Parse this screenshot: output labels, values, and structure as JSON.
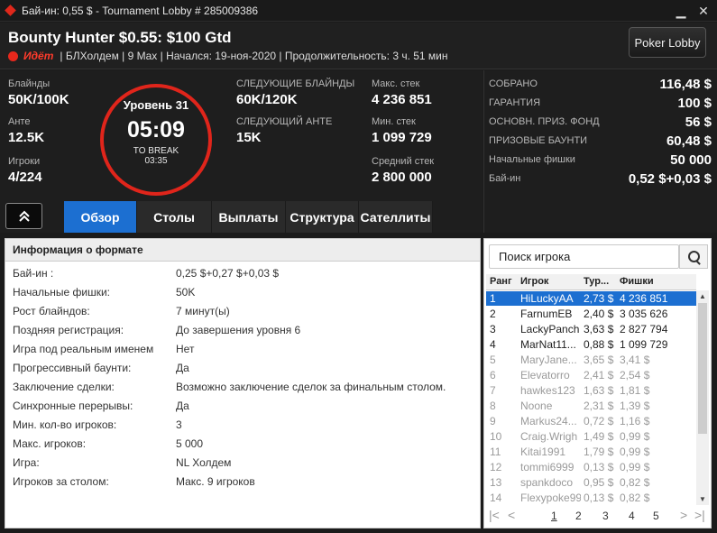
{
  "window": {
    "title": "Бай-ин: 0,55 $ - Tournament Lobby # 285009386"
  },
  "header": {
    "tournament_name": "Bounty Hunter $0.55: $100 Gtd",
    "status": "Идёт",
    "details": "| БЛХолдем | 9 Max | Начался: 19-ноя-2020 | Продолжительность: 3 ч. 51 мин",
    "poker_lobby_label": "Poker Lobby"
  },
  "stats": {
    "blinds_label": "Блайнды",
    "blinds": "50K/100K",
    "ante_label": "Анте",
    "ante": "12.5K",
    "players_label": "Игроки",
    "players": "4/224",
    "next_blinds_label": "СЛЕДУЮЩИЕ БЛАЙНДЫ",
    "next_blinds": "60K/120K",
    "next_ante_label": "СЛЕДУЮЩИЙ АНТЕ",
    "next_ante": "15K",
    "max_stack_label": "Макс. стек",
    "max_stack": "4 236 851",
    "min_stack_label": "Мин. стек",
    "min_stack": "1 099 729",
    "avg_stack_label": "Средний стек",
    "avg_stack": "2 800 000"
  },
  "clock": {
    "level": "Уровень 31",
    "time": "05:09",
    "to_break_label": "TO BREAK",
    "to_break_time": "03:35"
  },
  "prize": [
    {
      "label": "СОБРАНО",
      "value": "116,48 $"
    },
    {
      "label": "ГАРАНТИЯ",
      "value": "100 $"
    },
    {
      "label": "ОСНОВН. ПРИЗ. ФОНД",
      "value": "56 $"
    },
    {
      "label": "ПРИЗОВЫЕ БАУНТИ",
      "value": "60,48 $"
    },
    {
      "label": "Начальные фишки",
      "value": "50 000"
    },
    {
      "label": "Бай-ин",
      "value": "0,52 $+0,03 $"
    }
  ],
  "tabs": [
    {
      "label": "Обзор",
      "active": true
    },
    {
      "label": "Столы",
      "active": false
    },
    {
      "label": "Выплаты",
      "active": false
    },
    {
      "label": "Структура",
      "active": false
    },
    {
      "label": "Сателлиты",
      "active": false
    }
  ],
  "info": {
    "heading": "Информация о формате",
    "rows": [
      {
        "key": "Бай-ин :",
        "value": "0,25 $+0,27 $+0,03 $"
      },
      {
        "key": "Начальные фишки:",
        "value": "50K"
      },
      {
        "key": "Рост блайндов:",
        "value": "7 минут(ы)"
      },
      {
        "key": "Поздняя регистрация:",
        "value": "До завершения уровня 6"
      },
      {
        "key": "Игра под реальным именем",
        "value": "Нет"
      },
      {
        "key": "Прогрессивный баунти:",
        "value": "Да"
      },
      {
        "key": "Заключение сделки:",
        "value": "Возможно заключение сделок за финальным столом."
      },
      {
        "key": "Синхронные перерывы:",
        "value": "Да"
      },
      {
        "key": "Мин. кол-во игроков:",
        "value": "3"
      },
      {
        "key": "Макс. игроков:",
        "value": "5 000"
      },
      {
        "key": "Игра:",
        "value": "NL Холдем"
      },
      {
        "key": "Игроков за столом:",
        "value": "Макс. 9 игроков"
      }
    ]
  },
  "players": {
    "search_placeholder": "Поиск игрока",
    "columns": [
      "Ранг",
      "Игрок",
      "Тур...",
      "Фишки"
    ],
    "rows": [
      {
        "rank": "1",
        "name": "HiLuckyAA",
        "bounty": "2,73 $",
        "chips": "4 236 851",
        "state": "selected"
      },
      {
        "rank": "2",
        "name": "FarnumEB",
        "bounty": "2,40 $",
        "chips": "3 035 626",
        "state": "active"
      },
      {
        "rank": "3",
        "name": "LackyPanch",
        "bounty": "3,63 $",
        "chips": "2 827 794",
        "state": "active"
      },
      {
        "rank": "4",
        "name": "MarNat11...",
        "bounty": "0,88 $",
        "chips": "1 099 729",
        "state": "active"
      },
      {
        "rank": "5",
        "name": "MaryJane...",
        "bounty": "3,65 $",
        "chips": "3,41 $",
        "state": "out"
      },
      {
        "rank": "6",
        "name": "Elevatorro",
        "bounty": "2,41 $",
        "chips": "2,54 $",
        "state": "out"
      },
      {
        "rank": "7",
        "name": "hawkes123",
        "bounty": "1,63 $",
        "chips": "1,81 $",
        "state": "out"
      },
      {
        "rank": "8",
        "name": "Noone",
        "bounty": "2,31 $",
        "chips": "1,39 $",
        "state": "out"
      },
      {
        "rank": "9",
        "name": "Markus24...",
        "bounty": "0,72 $",
        "chips": "1,16 $",
        "state": "out"
      },
      {
        "rank": "10",
        "name": "Craig.Wrigh",
        "bounty": "1,49 $",
        "chips": "0,99 $",
        "state": "out"
      },
      {
        "rank": "11",
        "name": "Kitai1991",
        "bounty": "1,79 $",
        "chips": "0,99 $",
        "state": "out"
      },
      {
        "rank": "12",
        "name": "tommi6999",
        "bounty": "0,13 $",
        "chips": "0,99 $",
        "state": "out"
      },
      {
        "rank": "13",
        "name": "spankdoco",
        "bounty": "0,95 $",
        "chips": "0,82 $",
        "state": "out"
      },
      {
        "rank": "14",
        "name": "Flexypoke99",
        "bounty": "0,13 $",
        "chips": "0,82 $",
        "state": "out"
      }
    ],
    "pages": [
      "1",
      "2",
      "3",
      "4",
      "5"
    ],
    "current_page": "1"
  }
}
